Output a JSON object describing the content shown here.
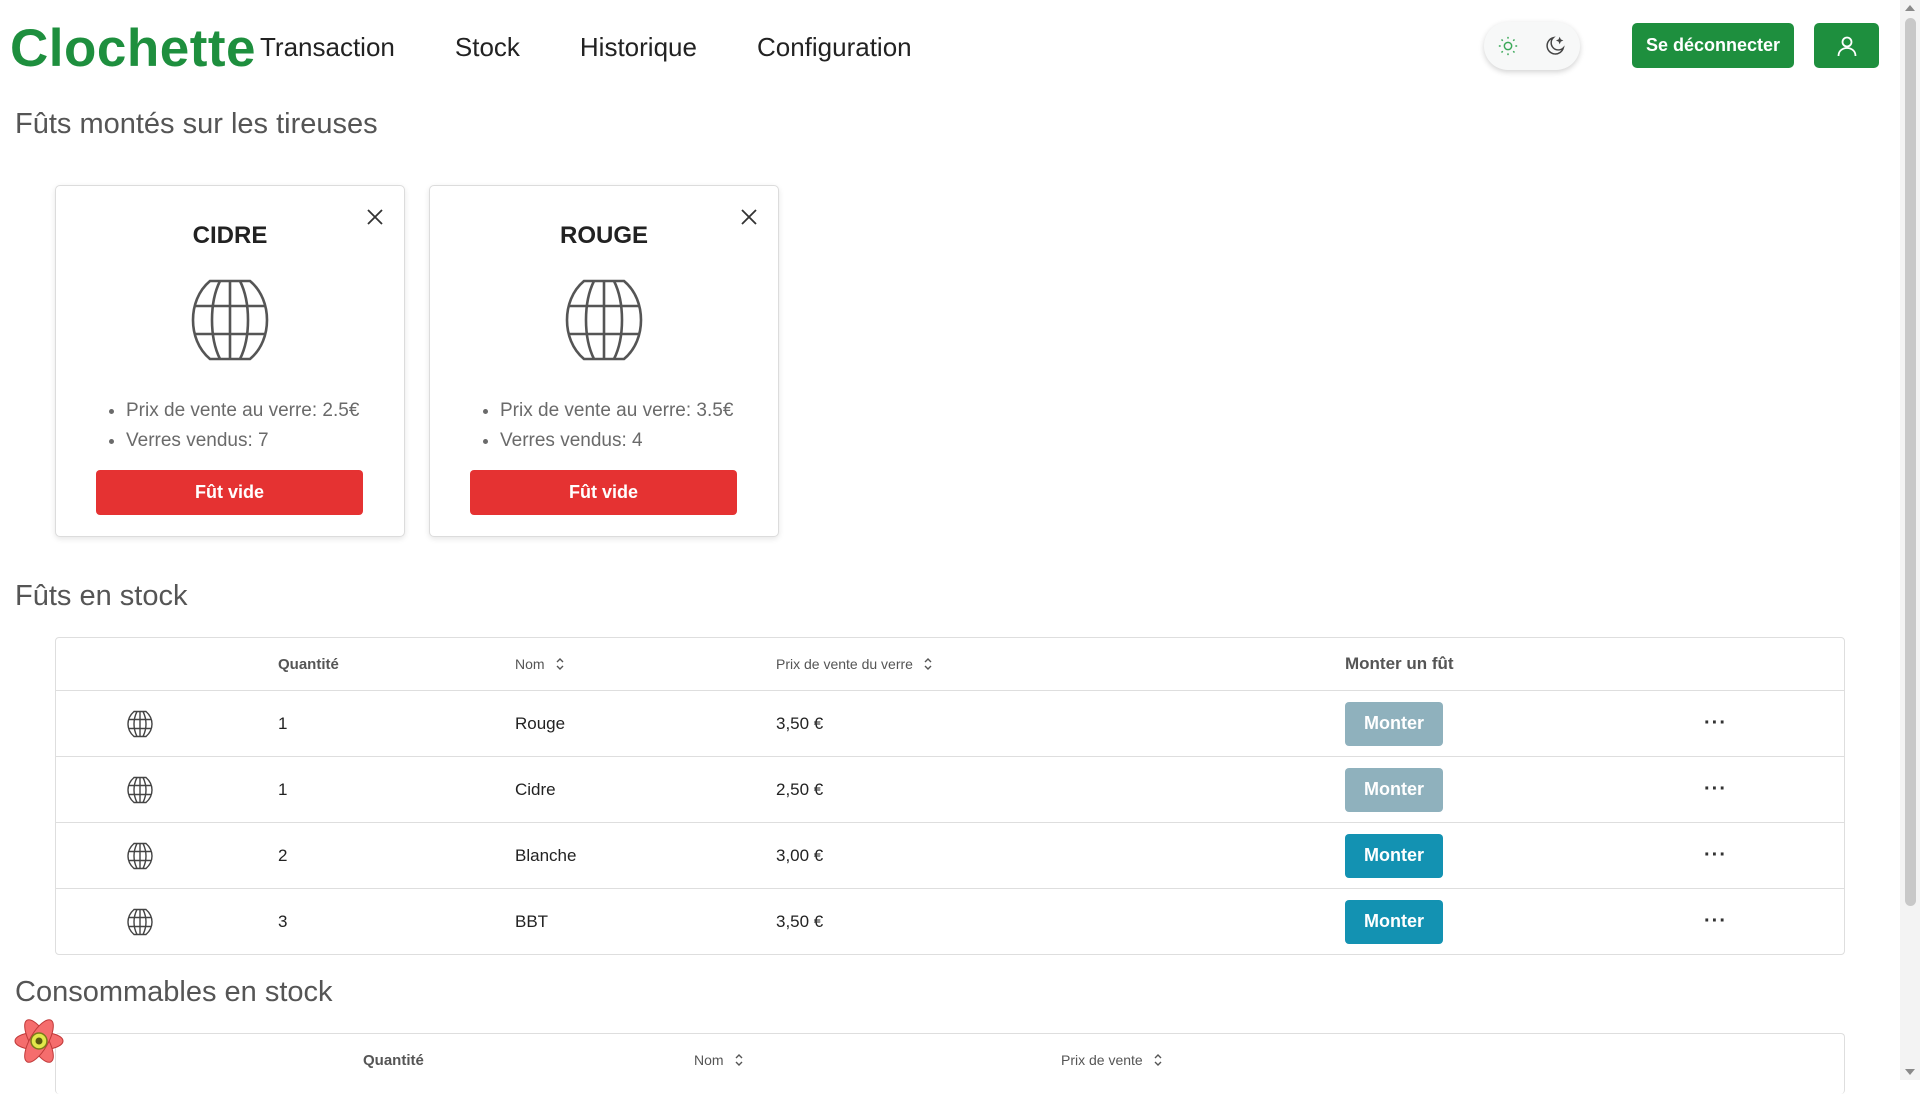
{
  "app": {
    "logo": "Clochette"
  },
  "nav": {
    "items": [
      "Transaction",
      "Stock",
      "Historique",
      "Configuration"
    ]
  },
  "header": {
    "logout_label": "Se déconnecter"
  },
  "sections": {
    "mounted_title": "Fûts montés sur les tireuses",
    "stock_title": "Fûts en stock",
    "consumables_title": "Consommables en stock"
  },
  "mounted_kegs": [
    {
      "name": "CIDRE",
      "price_line": "Prix de vente au verre: 2.5€",
      "sold_line": "Verres vendus: 7",
      "empty_label": "Fût vide"
    },
    {
      "name": "ROUGE",
      "price_line": "Prix de vente au verre: 3.5€",
      "sold_line": "Verres vendus: 4",
      "empty_label": "Fût vide"
    }
  ],
  "stock_table": {
    "headers": {
      "quantity": "Quantité",
      "name": "Nom",
      "price": "Prix de vente du verre",
      "mount": "Monter un fût"
    },
    "rows": [
      {
        "quantity": "1",
        "name": "Rouge",
        "price": "3,50 €",
        "mount_label": "Monter",
        "mount_enabled": false
      },
      {
        "quantity": "1",
        "name": "Cidre",
        "price": "2,50 €",
        "mount_label": "Monter",
        "mount_enabled": false
      },
      {
        "quantity": "2",
        "name": "Blanche",
        "price": "3,00 €",
        "mount_label": "Monter",
        "mount_enabled": true
      },
      {
        "quantity": "3",
        "name": "BBT",
        "price": "3,50 €",
        "mount_label": "Monter",
        "mount_enabled": true
      }
    ],
    "more_label": "···"
  },
  "consumables_table": {
    "headers": {
      "quantity": "Quantité",
      "name": "Nom",
      "price": "Prix de vente"
    }
  },
  "colors": {
    "brand": "#1e8f3e",
    "danger": "#e53232",
    "mount_enabled": "#1392b2",
    "mount_disabled": "#8fb1bd"
  },
  "icons": [
    "barrel-icon",
    "close-icon",
    "sun-icon",
    "moon-icon",
    "user-icon",
    "sort-icon",
    "more-icon",
    "react-devtools-icon"
  ]
}
